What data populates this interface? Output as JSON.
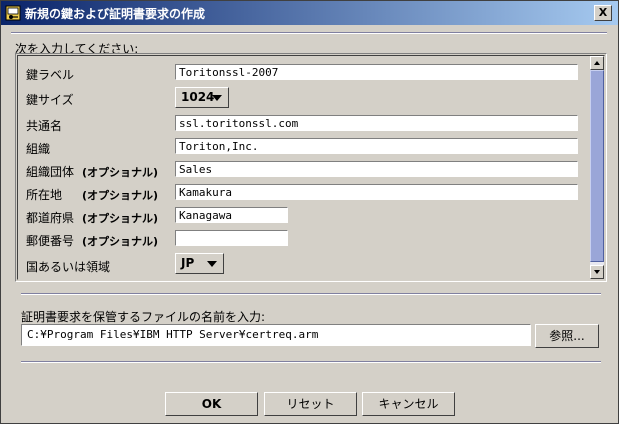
{
  "window": {
    "title": "新規の鍵および証明書要求の作成",
    "close_label": "X"
  },
  "form": {
    "instruction": "次を入力してください:",
    "rows": [
      {
        "label": "鍵ラベル",
        "optional": "",
        "value": "Toritonssl-2007"
      },
      {
        "label": "鍵サイズ",
        "optional": "",
        "value": "1024"
      },
      {
        "label": "共通名",
        "optional": "",
        "value": "ssl.toritonssl.com"
      },
      {
        "label": "組織",
        "optional": "",
        "value": "Toriton,Inc."
      },
      {
        "label": "組織団体",
        "optional": "(オプショナル)",
        "value": "Sales"
      },
      {
        "label": "所在地",
        "optional": "(オプショナル)",
        "value": "Kamakura"
      },
      {
        "label": "都道府県",
        "optional": "(オプショナル)",
        "value": "Kanagawa"
      },
      {
        "label": "郵便番号",
        "optional": "(オプショナル)",
        "value": ""
      },
      {
        "label": "国あるいは領域",
        "optional": "",
        "value": "JP"
      }
    ]
  },
  "file": {
    "label": "証明書要求を保管するファイルの名前を入力:",
    "value": "C:¥Program Files¥IBM HTTP Server¥certreq.arm",
    "browse_label": "参照..."
  },
  "buttons": {
    "ok": "OK",
    "reset": "リセット",
    "cancel": "キャンセル"
  },
  "icons": {
    "app": "key-certificate-icon",
    "close": "close-icon",
    "scroll_up": "scroll-up-arrow-icon",
    "scroll_down": "scroll-down-arrow-icon",
    "dropdown": "chevron-down-icon"
  }
}
